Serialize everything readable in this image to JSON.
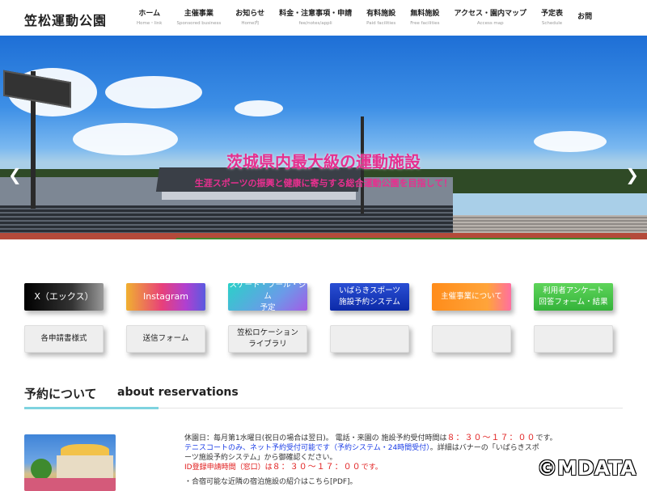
{
  "header": {
    "logo": "笠松運動公園",
    "nav": [
      {
        "label": "ホーム",
        "sub": "Home・link"
      },
      {
        "label": "主催事業",
        "sub": "Sponsored business"
      },
      {
        "label": "お知らせ",
        "sub": "Home内"
      },
      {
        "label": "料金・注意事項・申請",
        "sub": "fee/notes/appli"
      },
      {
        "label": "有料施設",
        "sub": "Paid facilities"
      },
      {
        "label": "無料施設",
        "sub": "Free facilities"
      },
      {
        "label": "アクセス・園内マップ",
        "sub": "Access map"
      },
      {
        "label": "予定表",
        "sub": "Schedule"
      },
      {
        "label": "お問",
        "sub": ""
      }
    ]
  },
  "hero": {
    "title": "茨城県内最大級の運動施設",
    "subtitle": "生涯スポーツの振興と健康に寄与する総合運動公園を目指して！",
    "prev_icon": "chevron-left-icon",
    "next_icon": "chevron-right-icon",
    "slide_count": 3,
    "active_slide": 1
  },
  "buttons": {
    "row1": [
      {
        "line1": "X（エックス）",
        "line2": ""
      },
      {
        "line1": "Instagram",
        "line2": ""
      },
      {
        "line1": "スケート・プール・ジム",
        "line2": "予定"
      },
      {
        "line1": "いばらきスポーツ",
        "line2": "施設予約システム"
      },
      {
        "line1": "主催事業について",
        "line2": ""
      },
      {
        "line1": "利用者アンケート",
        "line2": "回答フォーム・結果"
      }
    ],
    "row2": [
      {
        "line1": "各申請書様式",
        "line2": ""
      },
      {
        "line1": "送信フォーム",
        "line2": ""
      },
      {
        "line1": "笠松ロケーション",
        "line2": "ライブラリ"
      },
      {
        "line1": "",
        "line2": ""
      },
      {
        "line1": "",
        "line2": ""
      },
      {
        "line1": "",
        "line2": ""
      }
    ]
  },
  "reservations": {
    "title": "予約について",
    "title_en": "about reservations",
    "line1_a": "休園日：毎月第1水曜日(祝日の場合は翌日)。 電話・来園の 施設予約受付時間は",
    "line1_b": "８：３０～１７：００",
    "line1_c": "です。",
    "line2": "テニスコートのみ、ネット予約受付可能です（予約システム・24時間受付）",
    "line2_b": "。詳細はバナーの「いばらきスポ",
    "line3": "ーツ施設予約システム」から御確認ください。",
    "line4_a": "ID登録申請時間（窓口）は",
    "line4_b": "８：３０～１７：００",
    "line4_c": "です。",
    "line5": "・合宿可能な近隣の宿泊施設の紹介はこちら[PDF]。"
  },
  "watermark": "©MDATA",
  "colors": {
    "hero_text": "#e6308f",
    "accent_line": "#7fd3e0",
    "notice_red": "#e01a1a",
    "notice_blue": "#1a3ce6"
  }
}
